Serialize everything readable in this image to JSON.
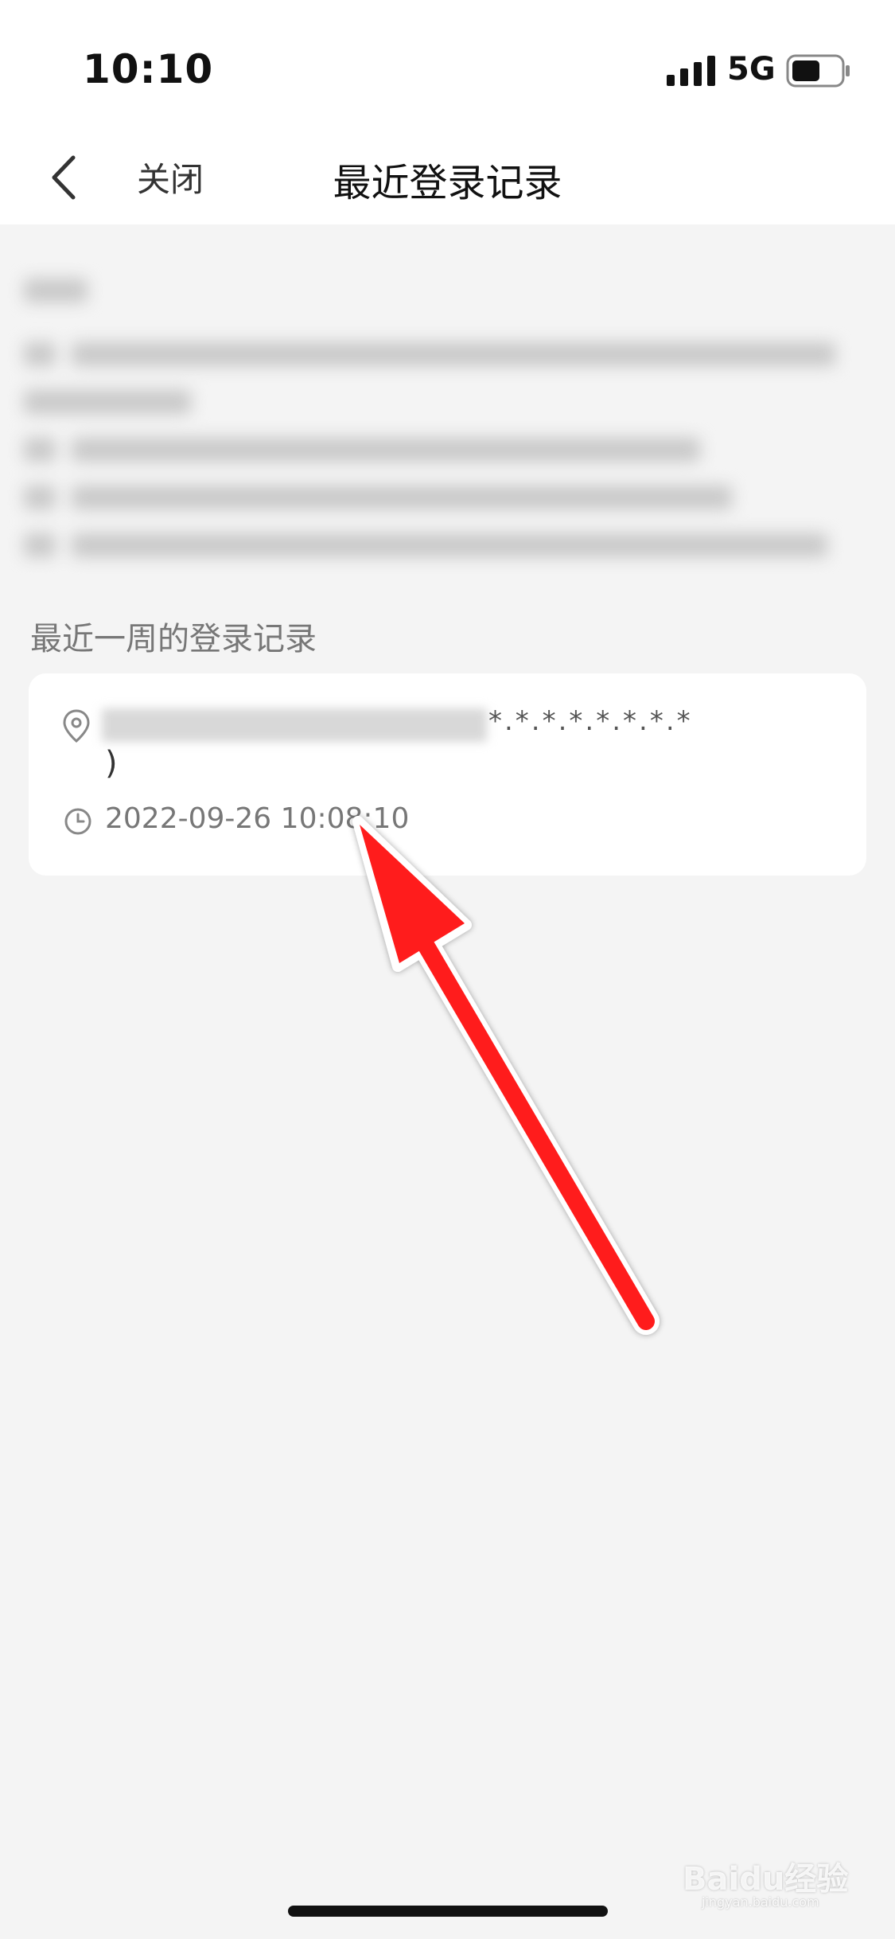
{
  "status_bar": {
    "time": "10:10",
    "network": "5G",
    "signal_icon": "signal-bars-icon",
    "battery_icon": "battery-icon"
  },
  "nav": {
    "back_icon": "chevron-left-icon",
    "close_label": "关闭",
    "title": "最近登录记录"
  },
  "section": {
    "title": "最近一周的登录记录"
  },
  "record": {
    "location_icon": "location-pin-icon",
    "location_masked": "*.*.*.*.*.*.*.*",
    "location_suffix": ")",
    "clock_icon": "clock-icon",
    "timestamp": "2022-09-26 10:08:10"
  },
  "annotation": {
    "arrow_color": "#ff1d1d"
  },
  "watermark": {
    "brand": "Baidu经验",
    "url": "jingyan.baidu.com"
  }
}
